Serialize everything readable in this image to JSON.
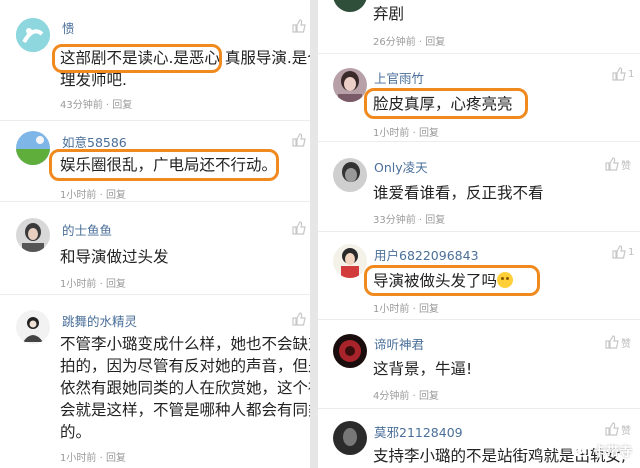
{
  "left_comments": [
    {
      "user": "愦",
      "text_line1": "这部剧不是读心.是恶心 真服导演.是个",
      "text_line2": "理发师吧.",
      "time": "43分钟前",
      "reply": "回复"
    },
    {
      "user": "如意58586",
      "text_line1": "娱乐圈很乱，广电局还不行动。",
      "time": "1小时前",
      "reply": "回复"
    },
    {
      "user": "的士鱼鱼",
      "text_line1": "和导演做过头发",
      "time": "1小时前",
      "reply": "回复"
    },
    {
      "user": "跳舞的水精灵",
      "text_line1": "不管李小璐变成什么样，她也不会缺对",
      "text_line2": "拍的，因为尽管有反对她的声音，但是",
      "text_line3": "依然有跟她同类的人在欣赏她，这个社",
      "text_line4": "会就是这样，不管是哪种人都会有同类",
      "text_line5": "的。",
      "time": "1小时前",
      "reply": "回复"
    }
  ],
  "right_comments": [
    {
      "user": "",
      "text_line1": "弃剧",
      "time": "26分钟前",
      "reply": "回复"
    },
    {
      "user": "上官雨竹",
      "text_line1": "脸皮真厚，心疼亮亮",
      "time": "1小时前",
      "reply": "回复",
      "likes": "1"
    },
    {
      "user": "Only凌天",
      "text_line1": "谁爱看谁看，反正我不看",
      "time": "33分钟前",
      "reply": "回复",
      "like_label": "赞"
    },
    {
      "user": "用户6822096843",
      "text_line1": "导演被做头发了吗",
      "time": "1小时前",
      "reply": "回复",
      "likes": "1"
    },
    {
      "user": "谛听神君",
      "text_line1": "这背景，牛逼!",
      "time": "4分钟前",
      "reply": "回复",
      "like_label": "赞"
    },
    {
      "user": "莫邪21128409",
      "text_line1": "支持李小璐的不是站街鸡就是出轨女,",
      "like_label": "赞"
    }
  ],
  "separator": "·",
  "watermark": "卡带寺",
  "colors": {
    "username": "#4a6f99",
    "highlight": "#f08a1e",
    "meta": "#9a9a9a"
  }
}
